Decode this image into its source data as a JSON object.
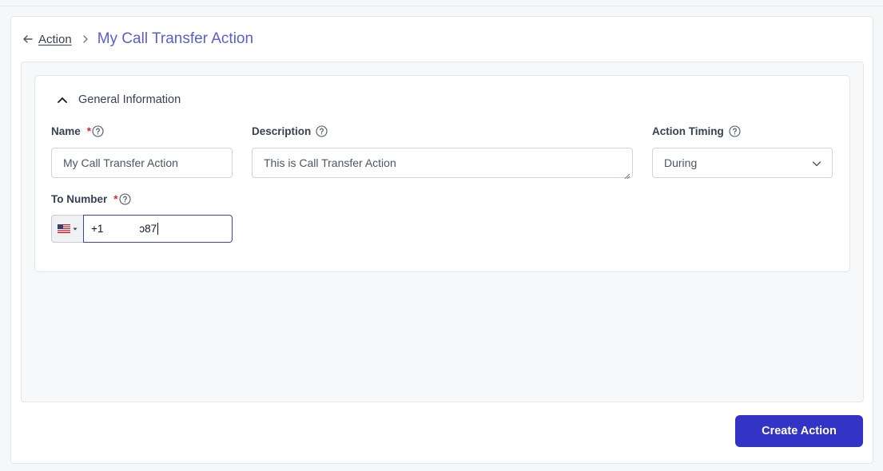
{
  "breadcrumb": {
    "parent_label": "Action",
    "current_label": "My Call Transfer Action"
  },
  "section": {
    "title": "General Information"
  },
  "fields": {
    "name": {
      "label": "Name",
      "required_mark": "*",
      "value": "My Call Transfer Action"
    },
    "description": {
      "label": "Description",
      "value": "This is Call Transfer Action"
    },
    "action_timing": {
      "label": "Action Timing",
      "value": "During"
    },
    "to_number": {
      "label": "To Number",
      "required_mark": "*",
      "value": "+1            ɔ87"
    }
  },
  "footer": {
    "create_label": "Create Action"
  },
  "colors": {
    "accent": "#3333c6",
    "title": "#5b5fc7",
    "required": "#dc2626"
  },
  "icons": [
    "back-arrow-icon",
    "chevron-right-icon",
    "chevron-up-icon",
    "help-icon",
    "chevron-down-icon",
    "us-flag-icon"
  ]
}
